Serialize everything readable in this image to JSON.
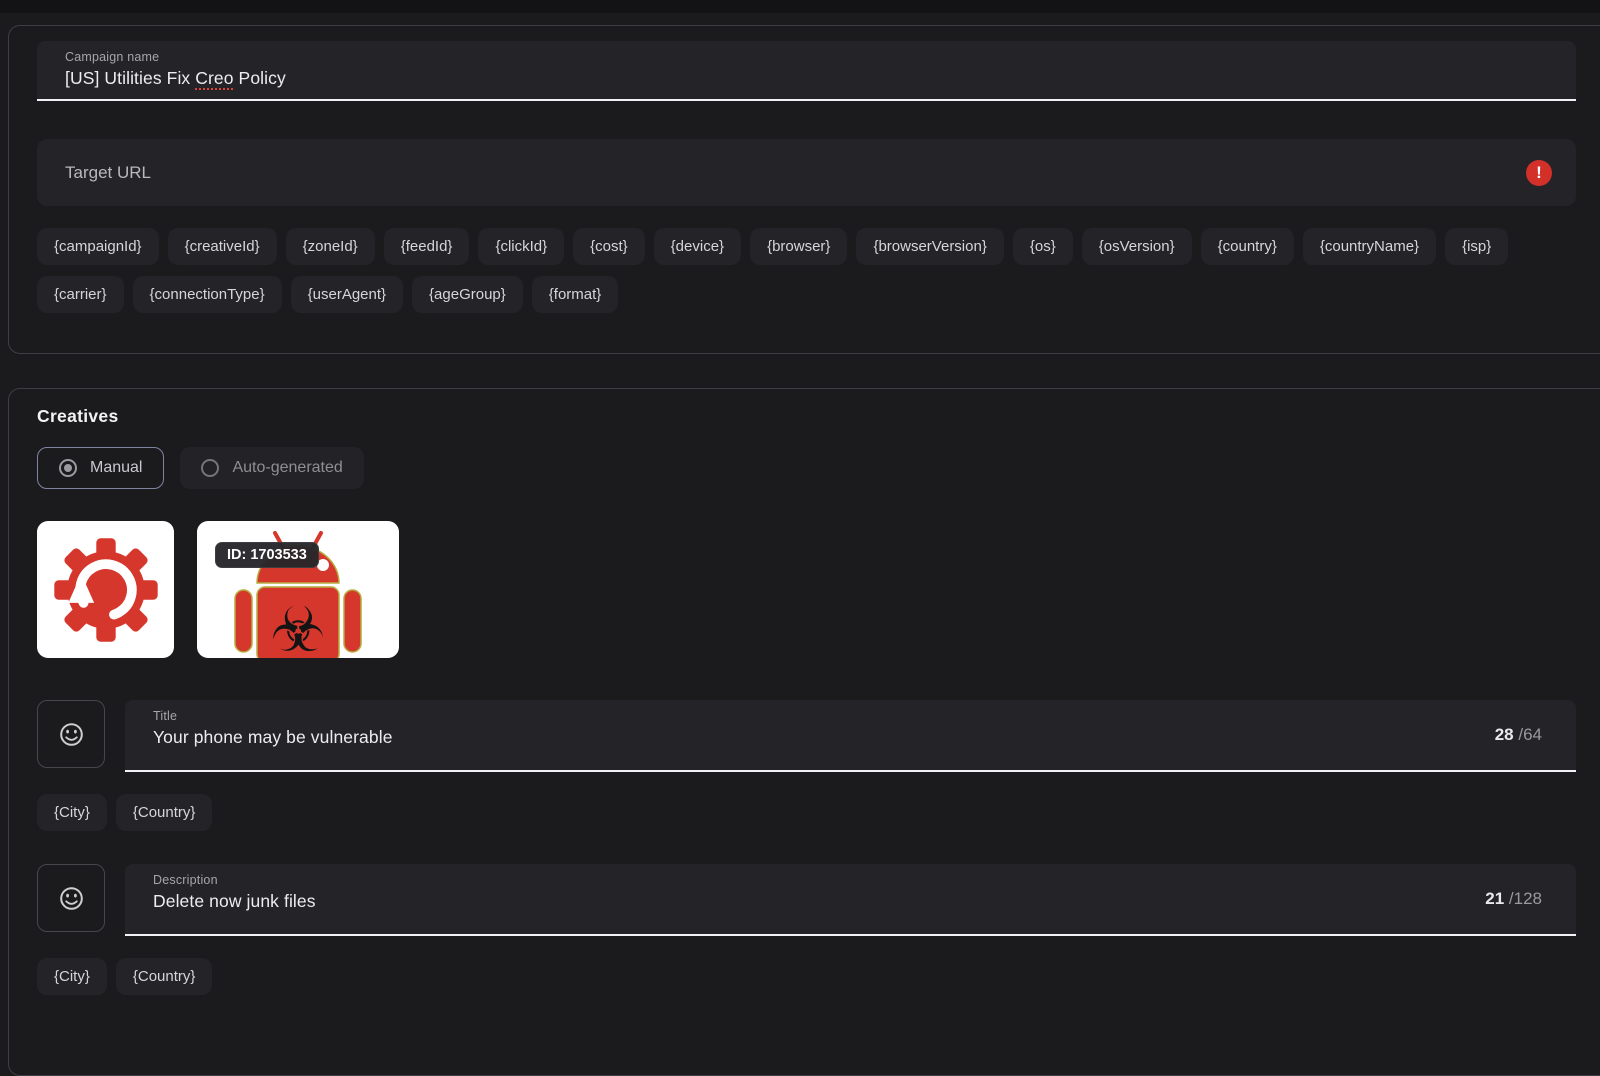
{
  "colors": {
    "page_bg": "#1b1b1e",
    "panel_border": "#3e3e44",
    "field_bg": "#242428",
    "underline": "#f2f2f4",
    "error_red": "#d3302a",
    "creative_red": "#d6372c",
    "creative_outline": "#b5ad3e",
    "selected_mode_border": "#7f84a2"
  },
  "icons": {
    "target_url_error": "exclamation-circle-icon",
    "emoji_picker": "smiley-icon",
    "creative_1": "gear-refresh-icon",
    "creative_2": "android-biohazard-icon",
    "radio_selected": "radio-checked-icon",
    "radio_unselected": "radio-unchecked-icon"
  },
  "campaign": {
    "name": {
      "label": "Campaign name",
      "pre": "[US] Utilities Fix ",
      "misspelled": "Creo",
      "post": " Policy"
    },
    "target_url": {
      "placeholder": "Target URL"
    },
    "macros": [
      "{campaignId}",
      "{creativeId}",
      "{zoneId}",
      "{feedId}",
      "{clickId}",
      "{cost}",
      "{device}",
      "{browser}",
      "{browserVersion}",
      "{os}",
      "{osVersion}",
      "{country}",
      "{countryName}",
      "{isp}",
      "{carrier}",
      "{connectionType}",
      "{userAgent}",
      "{ageGroup}",
      "{format}"
    ]
  },
  "creatives": {
    "heading": "Creatives",
    "modes": [
      {
        "label": "Manual",
        "selected": true
      },
      {
        "label": "Auto-generated",
        "selected": false
      }
    ],
    "thumbnails": [
      {
        "icon": "gear-refresh-icon"
      },
      {
        "icon": "android-biohazard-icon",
        "badge": "ID: 1703533"
      }
    ],
    "title": {
      "label": "Title",
      "value": "Your phone may be vulnerable",
      "count": "28",
      "limit": "/64",
      "macros": [
        "{City}",
        "{Country}"
      ]
    },
    "description": {
      "label": "Description",
      "value": "Delete now junk files",
      "count": "21",
      "limit": "/128",
      "macros": [
        "{City}",
        "{Country}"
      ]
    }
  }
}
